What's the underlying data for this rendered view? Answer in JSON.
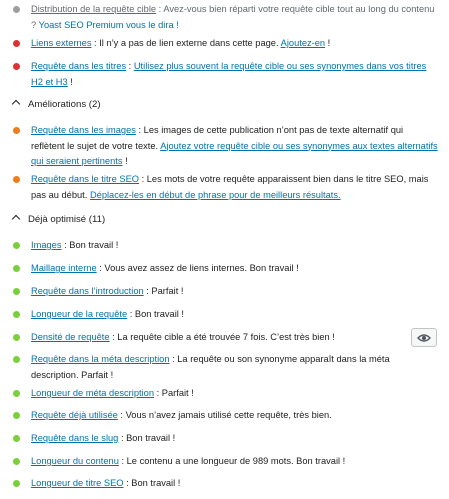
{
  "colors": {
    "grey": "#9e9e9e",
    "red": "#dc3232",
    "orange": "#ee7c1b",
    "green": "#7ad03a",
    "link": "#0073aa"
  },
  "problems": [
    {
      "link": "Distribution de la requête cible",
      "text": " : Avez-vous bien réparti votre requête cible tout au long du contenu ? ",
      "extra": "Yoast SEO Premium vous le dira !",
      "status": "grey"
    },
    {
      "link": "Liens externes",
      "text": " : Il n’y a pas de lien externe dans cette page. ",
      "extra": "Ajoutez-en",
      "tail": " !",
      "status": "red"
    },
    {
      "link": "Requête dans les titres",
      "text": " : ",
      "extra": "Utilisez plus souvent la requête cible ou ses synonymes dans vos titres H2 et H3",
      "tail": " !",
      "status": "red"
    }
  ],
  "improvements_header": "Améliorations (2)",
  "improvements": [
    {
      "link": "Requête dans les images",
      "text": " : Les images de cette publication n’ont pas de texte alternatif qui reflètent le sujet de votre texte. ",
      "extra": "Ajoutez votre requête cible ou ses synonymes aux textes alternatifs qui seraient pertinents",
      "tail": " !",
      "status": "orange"
    },
    {
      "link": "Requête dans le titre SEO",
      "text": " : Les mots de votre requête apparaissent bien dans le titre SEO, mais pas au début. ",
      "extra": "Déplacez-les en début de phrase pour de meilleurs résultats.",
      "tail": "",
      "status": "orange"
    }
  ],
  "good_header": "Déjà optimisé (11)",
  "good": [
    {
      "link": "Images",
      "text": " : Bon travail !"
    },
    {
      "link": "Maillage interne",
      "text": " : Vous avez assez de liens internes. Bon travail !"
    },
    {
      "link": "Requête dans l’introduction",
      "text": " : Parfait !"
    },
    {
      "link": "Longueur de la requête",
      "text": " : Bon travail !"
    },
    {
      "link": "Densité de requête",
      "text": " : La requête cible a été trouvée 7 fois. C’est très bien !"
    },
    {
      "link": "Requête dans la méta description",
      "text": " : La requête ou son synonyme apparaît dans la méta description. Parfait !"
    },
    {
      "link": "Longueur de méta description",
      "text": " : Parfait !"
    },
    {
      "link": "Requête déjà utilisée",
      "text": " : Vous n’avez jamais utilisé cette requête, très bien."
    },
    {
      "link": "Requête dans le slug",
      "text": " : Bon travail !"
    },
    {
      "link": "Longueur du contenu",
      "text": " : Le contenu a une longueur de 989 mots. Bon travail !"
    },
    {
      "link": "Longueur de titre SEO",
      "text": " : Bon travail !"
    }
  ],
  "eye_icon": "eye-icon"
}
